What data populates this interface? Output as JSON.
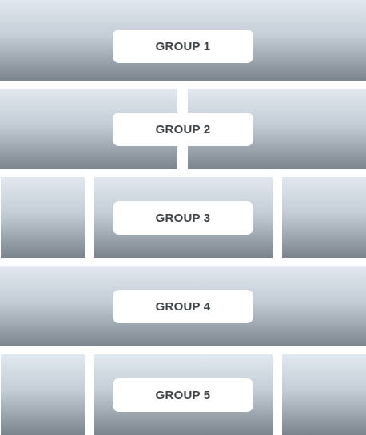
{
  "groups": [
    {
      "label": "GROUP 1"
    },
    {
      "label": "GROUP 2"
    },
    {
      "label": "GROUP 3"
    },
    {
      "label": "GROUP 4"
    },
    {
      "label": "GROUP 5"
    }
  ],
  "colors": {
    "tile_top": "#e1e8f0",
    "tile_bottom": "#7b838d",
    "label_background": "#ffffff",
    "label_text": "#3f4449",
    "page_background": "#ffffff"
  }
}
